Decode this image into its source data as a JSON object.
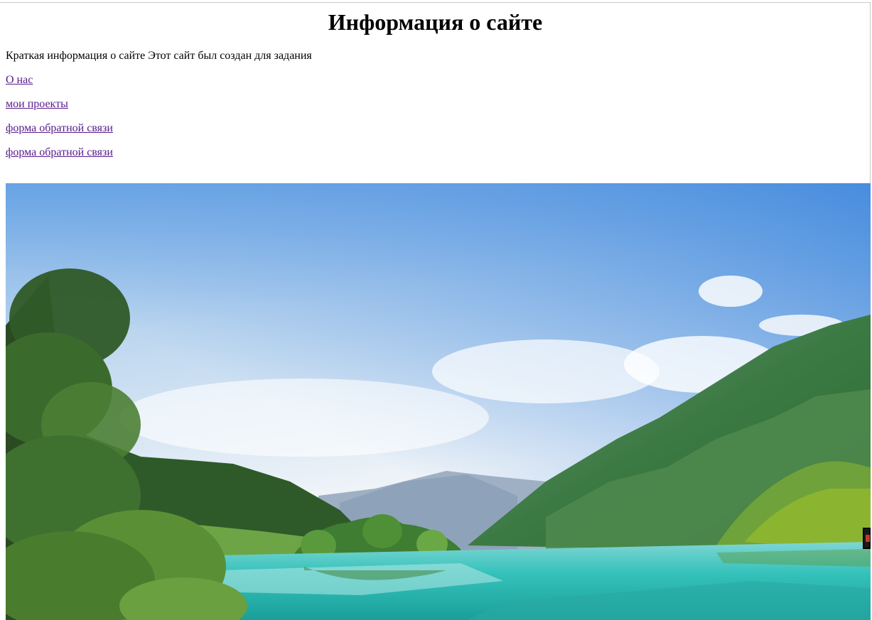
{
  "page": {
    "title": "Информация о сайте",
    "intro": "Краткая информация о сайте Этот сайт был создан для задания"
  },
  "nav": {
    "links": [
      {
        "label": "О нас"
      },
      {
        "label": "мои проекты"
      },
      {
        "label": "форма обратной связи"
      },
      {
        "label": "форма обратной связи"
      }
    ]
  },
  "hero_image": {
    "subject": "mountain-lake-landscape",
    "colors": {
      "sky_top": "#4a90d9",
      "sky_bottom": "#eef3f8",
      "water": "#2bbfb8",
      "mountain_green": "#3f7a3a",
      "link_visited": "#551a8b"
    }
  }
}
